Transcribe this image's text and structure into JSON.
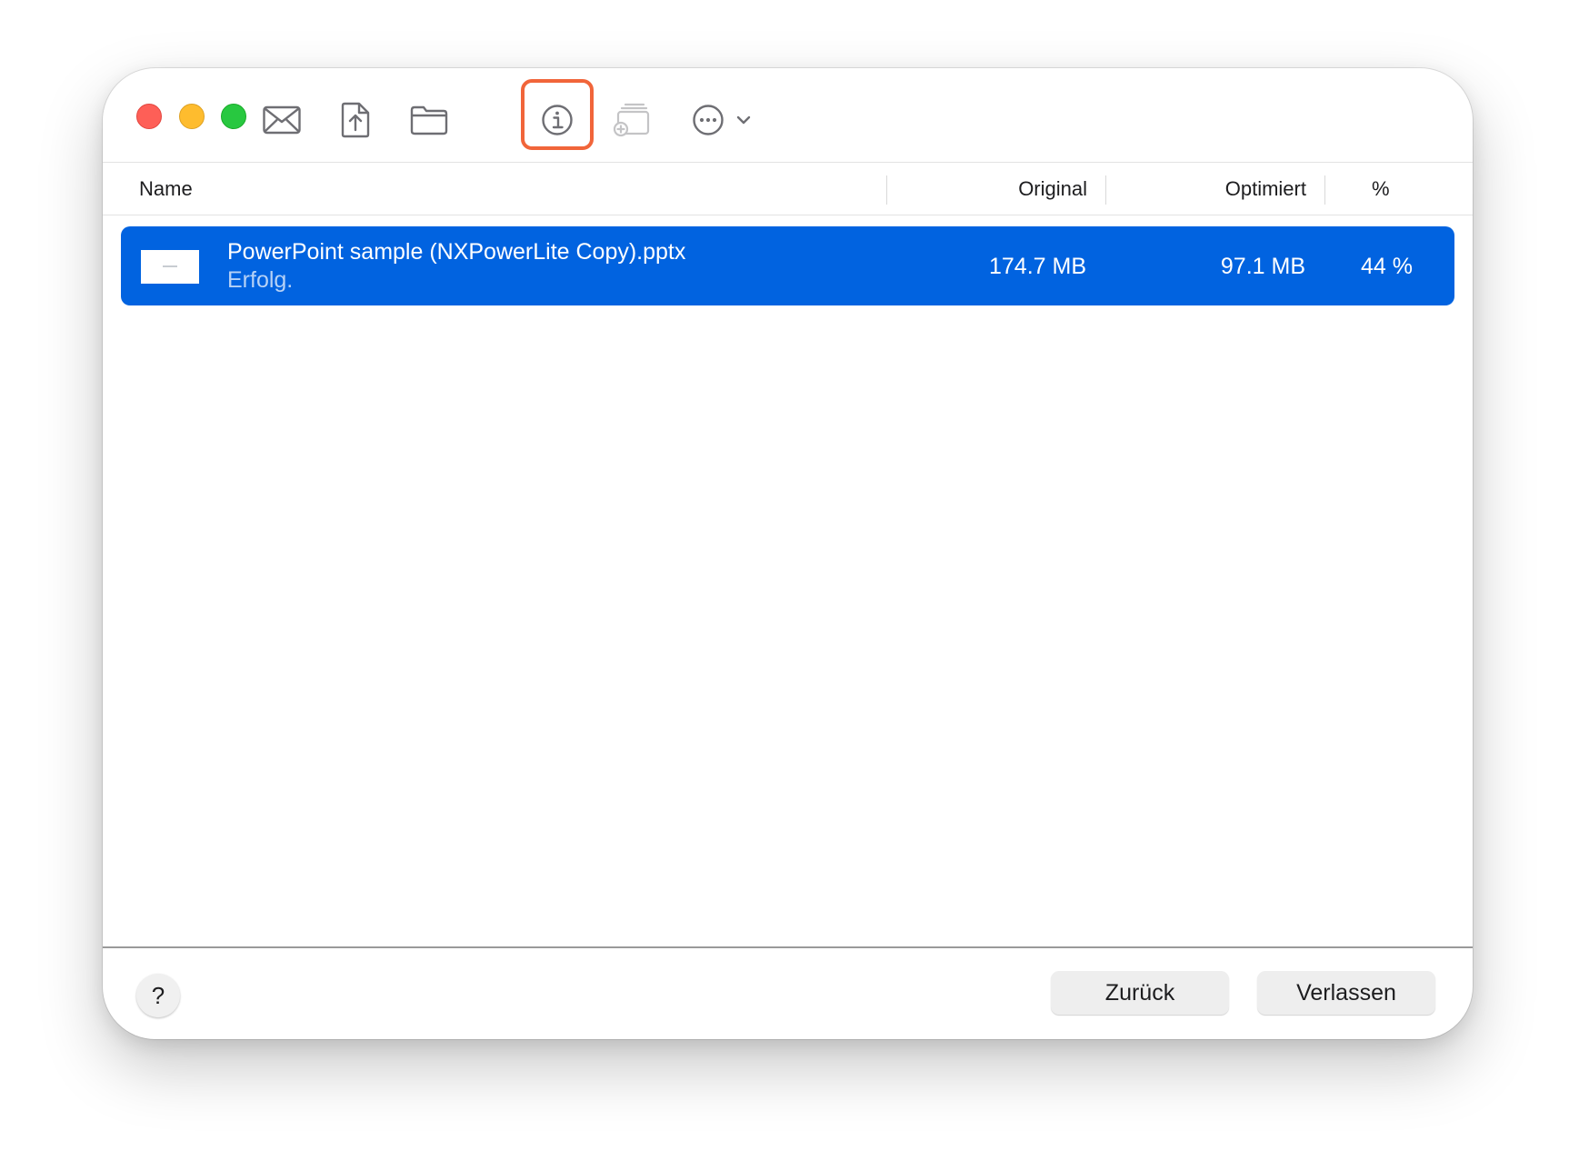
{
  "window": {
    "traffic_lights": [
      "close",
      "minimize",
      "zoom"
    ]
  },
  "toolbar": {
    "buttons": [
      {
        "name": "mail",
        "icon": "envelope-icon",
        "enabled": true
      },
      {
        "name": "share",
        "icon": "share-document-icon",
        "enabled": true
      },
      {
        "name": "reveal-folder",
        "icon": "folder-icon",
        "enabled": true
      },
      {
        "name": "info",
        "icon": "info-circle-icon",
        "enabled": true,
        "highlighted": true
      },
      {
        "name": "add-to-stack",
        "icon": "stack-add-icon",
        "enabled": false
      },
      {
        "name": "more",
        "icon": "ellipsis-circle-icon",
        "enabled": true
      }
    ],
    "highlight_color": "#f1653a"
  },
  "table": {
    "columns": {
      "name": "Name",
      "original": "Original",
      "optimized": "Optimiert",
      "percent": "%"
    },
    "rows": [
      {
        "file_name": "PowerPoint sample (NXPowerLite Copy).pptx",
        "status": "Erfolg.",
        "original": "174.7 MB",
        "optimized": "97.1 MB",
        "percent": "44 %",
        "selected": true
      }
    ],
    "selection_color": "#0163e0"
  },
  "footer": {
    "help_label": "?",
    "back_label": "Zurück",
    "quit_label": "Verlassen"
  }
}
